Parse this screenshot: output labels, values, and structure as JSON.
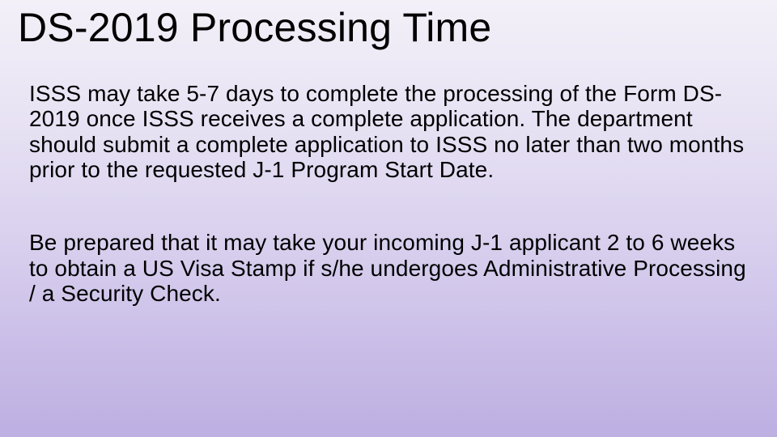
{
  "slide": {
    "title": "DS-2019 Processing Time",
    "paragraph1": "ISSS may take 5-7 days to complete the processing of the Form DS-2019 once ISSS receives a complete application. The department should submit a complete application to ISSS no later than two months prior to the requested J-1 Program Start Date.",
    "paragraph2": "Be prepared that it may take your incoming J-1 applicant 2 to 6 weeks to obtain a US Visa Stamp if  s/he undergoes Administrative Processing / a Security Check."
  }
}
